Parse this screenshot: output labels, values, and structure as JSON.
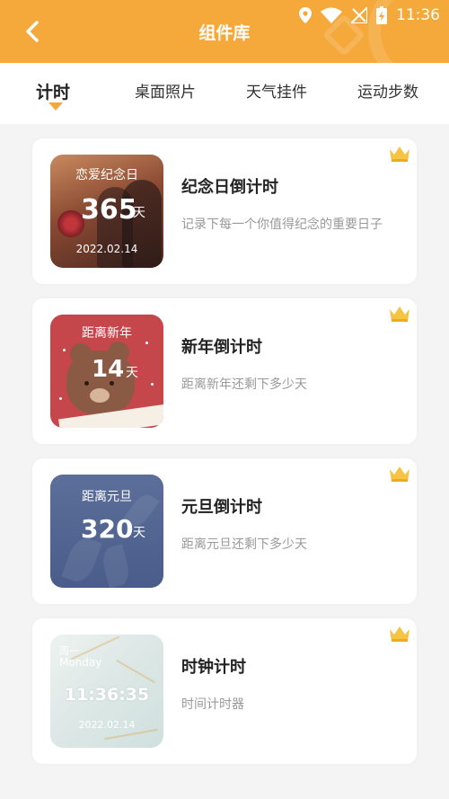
{
  "status_bar": {
    "time": "11:36"
  },
  "header": {
    "title": "组件库"
  },
  "tabs": [
    {
      "label": "计时",
      "active": true
    },
    {
      "label": "桌面照片",
      "active": false
    },
    {
      "label": "天气挂件",
      "active": false
    },
    {
      "label": "运动步数",
      "active": false
    }
  ],
  "cards": [
    {
      "title": "纪念日倒计时",
      "desc": "记录下每一个你值得纪念的重要日子",
      "thumb": {
        "label": "恋爱纪念日",
        "number": "365",
        "unit": "天",
        "date": "2022.02.14"
      }
    },
    {
      "title": "新年倒计时",
      "desc": "距离新年还剩下多少天",
      "thumb": {
        "label": "距离新年",
        "number": "14",
        "unit": "天"
      }
    },
    {
      "title": "元旦倒计时",
      "desc": "距离元旦还剩下多少天",
      "thumb": {
        "label": "距离元旦",
        "number": "320",
        "unit": "天"
      }
    },
    {
      "title": "时钟计时",
      "desc": "时间计时器",
      "thumb": {
        "weekday_cn": "周一",
        "weekday": "Monday",
        "time": "11:36:35",
        "date": "2022.02.14"
      }
    }
  ],
  "colors": {
    "accent": "#f5a93b",
    "crown": "#f6c343"
  }
}
